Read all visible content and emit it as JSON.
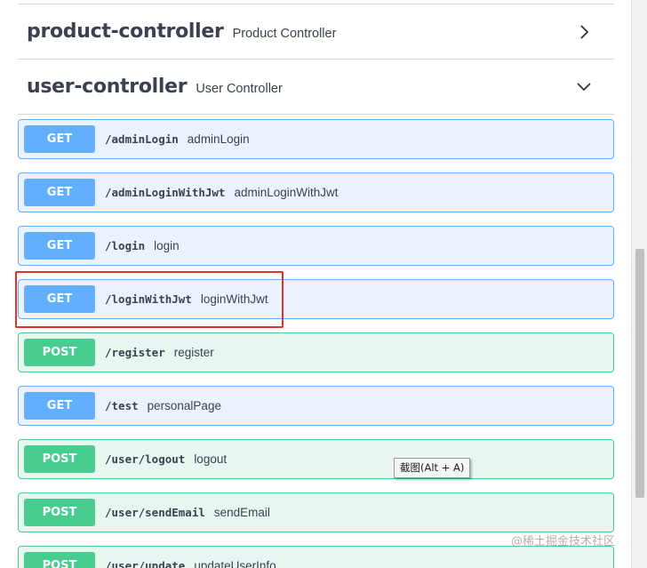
{
  "tags": [
    {
      "name": "product-controller",
      "description": "Product Controller",
      "expanded": false,
      "chevron": "chevron-right-icon"
    },
    {
      "name": "user-controller",
      "description": "User Controller",
      "expanded": true,
      "chevron": "chevron-down-icon"
    }
  ],
  "operations": [
    {
      "method": "GET",
      "path": "/adminLogin",
      "summary": "adminLogin"
    },
    {
      "method": "GET",
      "path": "/adminLoginWithJwt",
      "summary": "adminLoginWithJwt"
    },
    {
      "method": "GET",
      "path": "/login",
      "summary": "login"
    },
    {
      "method": "GET",
      "path": "/loginWithJwt",
      "summary": "loginWithJwt",
      "highlighted": true
    },
    {
      "method": "POST",
      "path": "/register",
      "summary": "register"
    },
    {
      "method": "GET",
      "path": "/test",
      "summary": "personalPage"
    },
    {
      "method": "POST",
      "path": "/user/logout",
      "summary": "logout"
    },
    {
      "method": "POST",
      "path": "/user/sendEmail",
      "summary": "sendEmail"
    },
    {
      "method": "POST",
      "path": "/user/update",
      "summary": "updateUserInfo"
    }
  ],
  "tooltip": {
    "text": "截图(Alt + A)"
  },
  "watermark": {
    "text": "@稀土掘金技术社区"
  },
  "colors": {
    "get": "#61affe",
    "get_bg": "#eaf3fd",
    "post": "#49cc90",
    "post_bg": "#e8f6f0",
    "highlight": "#e0312d",
    "text": "#3b4151"
  }
}
